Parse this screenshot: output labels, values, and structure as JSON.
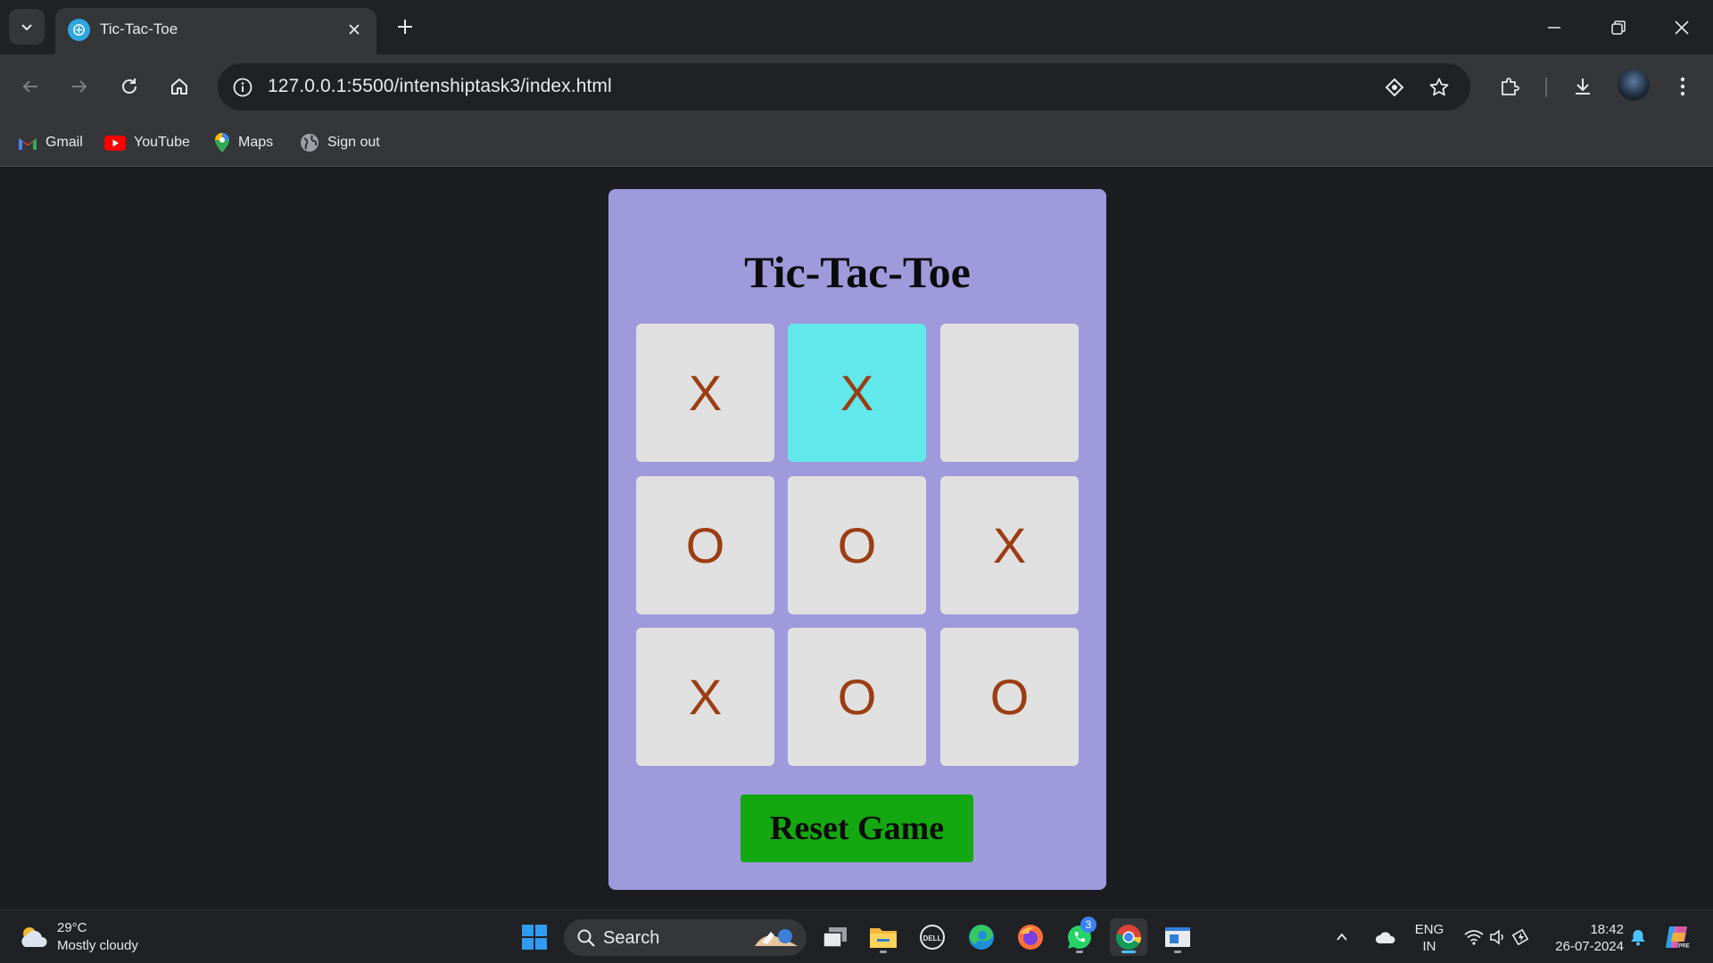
{
  "browser": {
    "tab_title": "Tic-Tac-Toe",
    "url": "127.0.0.1:5500/intenshiptask3/index.html",
    "bookmarks": [
      {
        "label": "Gmail",
        "icon": "gmail-icon"
      },
      {
        "label": "YouTube",
        "icon": "youtube-icon"
      },
      {
        "label": "Maps",
        "icon": "maps-icon"
      },
      {
        "label": "Sign out",
        "icon": "globe-icon"
      }
    ]
  },
  "game": {
    "title": "Tic-Tac-Toe",
    "board": [
      "X",
      "X",
      "",
      "O",
      "O",
      "X",
      "X",
      "O",
      "O"
    ],
    "highlighted_cell": 1,
    "reset_label": "Reset Game",
    "colors": {
      "card": "#9e9adc",
      "cell": "#e0e0e0",
      "highlight": "#62e8ea",
      "mark": "#9b3d12",
      "reset": "#13a80f"
    }
  },
  "taskbar": {
    "weather_temp": "29°C",
    "weather_desc": "Mostly cloudy",
    "search_label": "Search",
    "whatsapp_badge": "3",
    "lang_top": "ENG",
    "lang_bottom": "IN",
    "time": "18:42",
    "date": "26-07-2024"
  }
}
